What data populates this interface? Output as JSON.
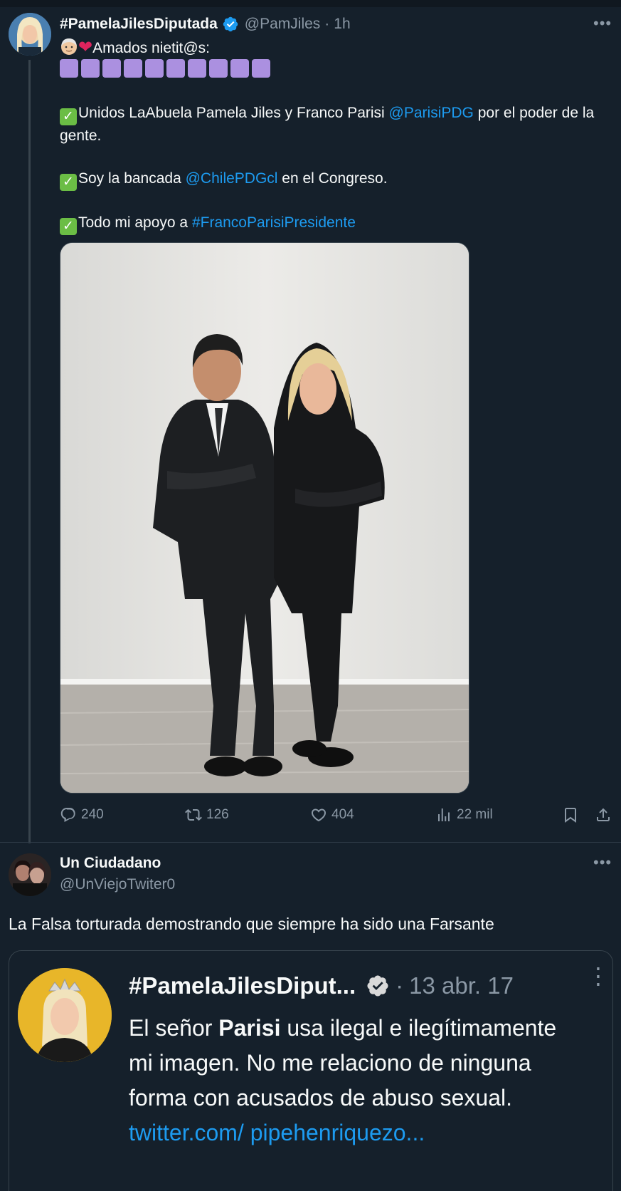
{
  "tweet1": {
    "author_name": "#PamelaJilesDiputada",
    "handle": "@PamJiles",
    "separator": "·",
    "time": "1h",
    "intro_text": "Amados nietit@s:",
    "intro_icons": [
      "older-woman-emoji",
      "red-heart-emoji"
    ],
    "purple_squares": 10,
    "line1_pre": "Unidos LaAbuela Pamela Jiles y Franco Parisi ",
    "line1_mention": "@ParisiPDG",
    "line1_post": " por el poder de la gente.",
    "line2_pre": "Soy la bancada ",
    "line2_mention": "@ChilePDGcl",
    "line2_post": " en el Congreso.",
    "line3_pre": "Todo mi apoyo a ",
    "line3_hashtag": "#FrancoParisiPresidente",
    "bullet_icon": "check-mark-emoji",
    "actions": {
      "replies": "240",
      "retweets": "126",
      "likes": "404",
      "views": "22 mil"
    }
  },
  "tweet2": {
    "author_name": "Un Ciudadano",
    "handle": "@UnViejoTwiter0",
    "text": "La Falsa torturada demostrando que siempre ha sido una Farsante"
  },
  "quote": {
    "author_name": "#PamelaJilesDiput...",
    "separator": "·",
    "time": "13 abr. 17",
    "text_pre": "El señor ",
    "text_bold": "Parisi",
    "text_mid": " usa ilegal e ilegítimamente mi imagen. No me relaciono de ninguna forma con acusados de abuso sexual. ",
    "text_link": "twitter.com/ pipehenriquezo..."
  },
  "colors": {
    "background": "#15202b",
    "accent_link": "#1d9bf0",
    "secondary_text": "#8b98a5",
    "verified_blue": "#1d9bf0",
    "check_green": "#6bbd45",
    "purple_square": "#ab90e0"
  }
}
